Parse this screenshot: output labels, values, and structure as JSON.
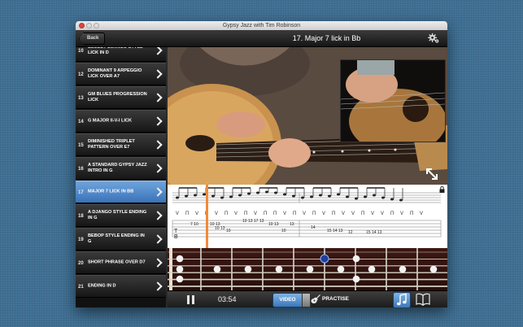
{
  "window": {
    "title": "Gypsy Jazz with Tim Robinson"
  },
  "navbar": {
    "back_label": "Back",
    "title": "17. Major 7 lick in Bb"
  },
  "lessons": [
    {
      "num": "10",
      "label": "Bluesy Django style lick in D"
    },
    {
      "num": "12",
      "label": "Dominant 9 arpeggio lick over A7"
    },
    {
      "num": "13",
      "label": "Gm blues progression lick"
    },
    {
      "num": "14",
      "label": "G major II-V-I lick"
    },
    {
      "num": "15",
      "label": "Diminished triplet pattern over E7"
    },
    {
      "num": "16",
      "label": "A standard gypsy jazz intro in G"
    },
    {
      "num": "17",
      "label": "Major 7 lick in Bb",
      "active": true
    },
    {
      "num": "18",
      "label": "A Django style ending in G"
    },
    {
      "num": "19",
      "label": "Bebop style ending in G"
    },
    {
      "num": "20",
      "label": "Short phrase over D7"
    },
    {
      "num": "21",
      "label": "Ending in D"
    }
  ],
  "notation": {
    "picks": [
      "V",
      "Π",
      "V",
      "Π",
      "V",
      "Π",
      "V",
      "Π",
      "V",
      "Π",
      "Π",
      "V",
      "Π",
      "V",
      "Π",
      "V",
      "Π",
      "V",
      "V",
      "Π",
      "V",
      "V",
      "Π",
      "V",
      "Π",
      "V"
    ],
    "tab_numbers": [
      "7 10",
      "10 13",
      "10 13",
      "10",
      "10 13 17 13",
      "10 13",
      "10",
      "13",
      "14",
      "15 14 13",
      "12",
      "15 14 13"
    ]
  },
  "toolbar": {
    "time": "03:54",
    "video_label": "VIDEO",
    "practise_label": "PRACTISE"
  },
  "colors": {
    "accent": "#3d77b8",
    "active_item": "#5a8fd0",
    "progress": "#f08a3a",
    "fret_dot": "#f2f2f2",
    "current_note": "#1f3f9a"
  }
}
